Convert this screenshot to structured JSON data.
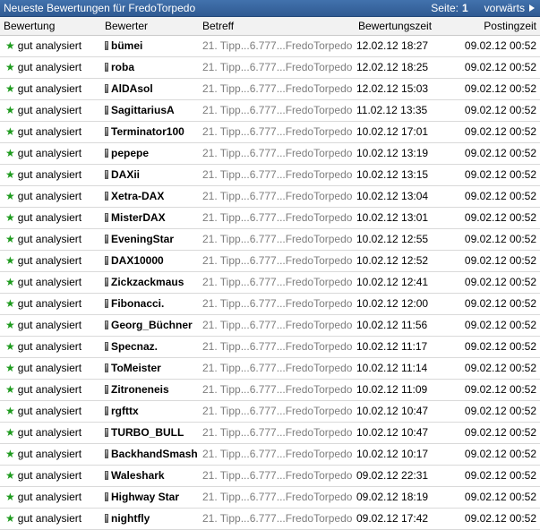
{
  "header": {
    "title": "Neueste Bewertungen für FredoTorpedo",
    "page_label": "Seite:",
    "page_number": "1",
    "next_label": "vorwärts"
  },
  "columns": {
    "rating": "Bewertung",
    "rater": "Bewerter",
    "subject": "Betreff",
    "rating_time": "Bewertungszeit",
    "posting_time": "Postingzeit"
  },
  "rows": [
    {
      "rating": "gut analysiert",
      "user": "bümei",
      "subject": "21. Tipp...6.777...FredoTorpedo",
      "rating_time": "12.02.12 18:27",
      "posting_time": "09.02.12 00:52"
    },
    {
      "rating": "gut analysiert",
      "user": "roba",
      "subject": "21. Tipp...6.777...FredoTorpedo",
      "rating_time": "12.02.12 18:25",
      "posting_time": "09.02.12 00:52"
    },
    {
      "rating": "gut analysiert",
      "user": "AlDAsol",
      "subject": "21. Tipp...6.777...FredoTorpedo",
      "rating_time": "12.02.12 15:03",
      "posting_time": "09.02.12 00:52"
    },
    {
      "rating": "gut analysiert",
      "user": "SagittariusA",
      "subject": "21. Tipp...6.777...FredoTorpedo",
      "rating_time": "11.02.12 13:35",
      "posting_time": "09.02.12 00:52"
    },
    {
      "rating": "gut analysiert",
      "user": "Terminator100",
      "subject": "21. Tipp...6.777...FredoTorpedo",
      "rating_time": "10.02.12 17:01",
      "posting_time": "09.02.12 00:52"
    },
    {
      "rating": "gut analysiert",
      "user": "pepepe",
      "subject": "21. Tipp...6.777...FredoTorpedo",
      "rating_time": "10.02.12 13:19",
      "posting_time": "09.02.12 00:52"
    },
    {
      "rating": "gut analysiert",
      "user": "DAXii",
      "subject": "21. Tipp...6.777...FredoTorpedo",
      "rating_time": "10.02.12 13:15",
      "posting_time": "09.02.12 00:52"
    },
    {
      "rating": "gut analysiert",
      "user": "Xetra-DAX",
      "subject": "21. Tipp...6.777...FredoTorpedo",
      "rating_time": "10.02.12 13:04",
      "posting_time": "09.02.12 00:52"
    },
    {
      "rating": "gut analysiert",
      "user": "MisterDAX",
      "subject": "21. Tipp...6.777...FredoTorpedo",
      "rating_time": "10.02.12 13:01",
      "posting_time": "09.02.12 00:52"
    },
    {
      "rating": "gut analysiert",
      "user": "EveningStar",
      "subject": "21. Tipp...6.777...FredoTorpedo",
      "rating_time": "10.02.12 12:55",
      "posting_time": "09.02.12 00:52"
    },
    {
      "rating": "gut analysiert",
      "user": "DAX10000",
      "subject": "21. Tipp...6.777...FredoTorpedo",
      "rating_time": "10.02.12 12:52",
      "posting_time": "09.02.12 00:52"
    },
    {
      "rating": "gut analysiert",
      "user": "Zickzackmaus",
      "subject": "21. Tipp...6.777...FredoTorpedo",
      "rating_time": "10.02.12 12:41",
      "posting_time": "09.02.12 00:52"
    },
    {
      "rating": "gut analysiert",
      "user": "Fibonacci.",
      "subject": "21. Tipp...6.777...FredoTorpedo",
      "rating_time": "10.02.12 12:00",
      "posting_time": "09.02.12 00:52"
    },
    {
      "rating": "gut analysiert",
      "user": "Georg_Büchner",
      "subject": "21. Tipp...6.777...FredoTorpedo",
      "rating_time": "10.02.12 11:56",
      "posting_time": "09.02.12 00:52"
    },
    {
      "rating": "gut analysiert",
      "user": "Specnaz.",
      "subject": "21. Tipp...6.777...FredoTorpedo",
      "rating_time": "10.02.12 11:17",
      "posting_time": "09.02.12 00:52"
    },
    {
      "rating": "gut analysiert",
      "user": "ToMeister",
      "subject": "21. Tipp...6.777...FredoTorpedo",
      "rating_time": "10.02.12 11:14",
      "posting_time": "09.02.12 00:52"
    },
    {
      "rating": "gut analysiert",
      "user": "Zitroneneis",
      "subject": "21. Tipp...6.777...FredoTorpedo",
      "rating_time": "10.02.12 11:09",
      "posting_time": "09.02.12 00:52"
    },
    {
      "rating": "gut analysiert",
      "user": "rgfttx",
      "subject": "21. Tipp...6.777...FredoTorpedo",
      "rating_time": "10.02.12 10:47",
      "posting_time": "09.02.12 00:52"
    },
    {
      "rating": "gut analysiert",
      "user": "TURBO_BULL",
      "subject": "21. Tipp...6.777...FredoTorpedo",
      "rating_time": "10.02.12 10:47",
      "posting_time": "09.02.12 00:52"
    },
    {
      "rating": "gut analysiert",
      "user": "BackhandSmash",
      "subject": "21. Tipp...6.777...FredoTorpedo",
      "rating_time": "10.02.12 10:17",
      "posting_time": "09.02.12 00:52"
    },
    {
      "rating": "gut analysiert",
      "user": "Waleshark",
      "subject": "21. Tipp...6.777...FredoTorpedo",
      "rating_time": "09.02.12 22:31",
      "posting_time": "09.02.12 00:52"
    },
    {
      "rating": "gut analysiert",
      "user": "Highway Star",
      "subject": "21. Tipp...6.777...FredoTorpedo",
      "rating_time": "09.02.12 18:19",
      "posting_time": "09.02.12 00:52"
    },
    {
      "rating": "gut analysiert",
      "user": "nightfly",
      "subject": "21. Tipp...6.777...FredoTorpedo",
      "rating_time": "09.02.12 17:42",
      "posting_time": "09.02.12 00:52"
    }
  ],
  "icons": {
    "rating": "star-icon",
    "user": "user-status-icon",
    "next": "triangle-right-icon"
  },
  "colors": {
    "header_bg": "#36629b",
    "star": "#1e9b1e",
    "subject_text": "#7d7d7d"
  }
}
